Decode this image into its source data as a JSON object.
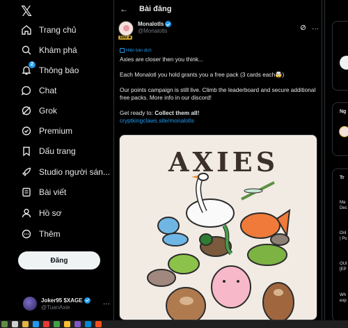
{
  "app": {
    "logo": "𝕏"
  },
  "nav": {
    "items": [
      {
        "label": "Trang chủ",
        "icon": "home-icon"
      },
      {
        "label": "Khám phá",
        "icon": "search-icon"
      },
      {
        "label": "Thông báo",
        "icon": "bell-icon",
        "badge": "2"
      },
      {
        "label": "Chat",
        "icon": "chat-icon"
      },
      {
        "label": "Grok",
        "icon": "grok-icon"
      },
      {
        "label": "Premium",
        "icon": "premium-icon"
      },
      {
        "label": "Dấu trang",
        "icon": "bookmark-icon"
      },
      {
        "label": "Studio người sán...",
        "icon": "rocket-icon"
      },
      {
        "label": "Bài viết",
        "icon": "articles-icon"
      },
      {
        "label": "Hồ sơ",
        "icon": "profile-icon"
      },
      {
        "label": "Thêm",
        "icon": "more-icon"
      }
    ],
    "post_button": "Đăng",
    "account": {
      "name": "Joker95 $XAGE",
      "handle": "@TuanAxie",
      "more": "···"
    }
  },
  "main": {
    "header_title": "Bài đăng",
    "author": {
      "name": "Monalotls",
      "handle": "@Monalotls",
      "tag": "1162 ⊕"
    },
    "translate_label": "Hiện bản dịch",
    "tweet": {
      "line1": "Axies are closer then you think...",
      "line2": "Each Monalotl you hold grants you a free pack (3 cards each🤯)",
      "line3": "Our points campaign is still live. Climb the leaderboard and secure additional free packs. More info in our discord!",
      "line4_prefix": "Get ready to: ",
      "line4_bold": "Collect them all!",
      "link": "cryptkingclaws.site/monalotls"
    },
    "media_title": "AXIES"
  },
  "right": {
    "section1": "Ng",
    "section2": "Tr",
    "trends": [
      {
        "line1": "Ma",
        "line2": "Dec"
      },
      {
        "line1": "Onl",
        "line2": "| Pu"
      },
      {
        "line1": "OUI",
        "line2": "[EP"
      },
      {
        "line1": "Wh",
        "line2": "exp"
      }
    ]
  },
  "colors": {
    "accent": "#1d9bf0",
    "background": "#000000",
    "border": "#2f3336",
    "muted": "#71767b"
  }
}
